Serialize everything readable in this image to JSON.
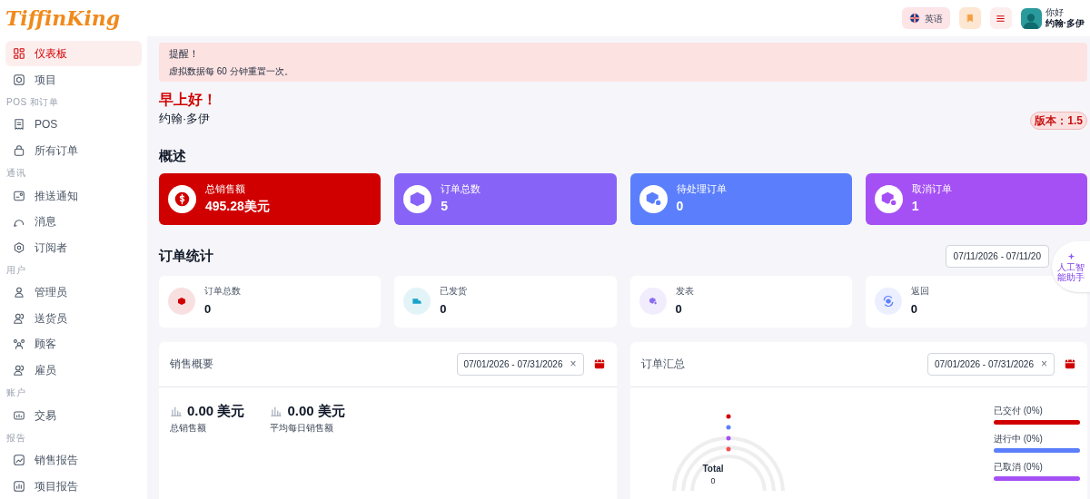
{
  "header": {
    "logo": "TiffinKing",
    "language": "英语",
    "greeting": "你好",
    "user_name": "约翰·多伊"
  },
  "sidebar": [
    {
      "kind": "item",
      "label": "仪表板",
      "selected": true
    },
    {
      "kind": "item",
      "label": "项目",
      "selected": false
    },
    {
      "kind": "section",
      "label": "POS 和订单"
    },
    {
      "kind": "item",
      "label": "POS",
      "selected": false
    },
    {
      "kind": "item",
      "label": "所有订单",
      "selected": false
    },
    {
      "kind": "section",
      "label": "通讯"
    },
    {
      "kind": "item",
      "label": "推送通知",
      "selected": false
    },
    {
      "kind": "item",
      "label": "消息",
      "selected": false
    },
    {
      "kind": "item",
      "label": "订阅者",
      "selected": false
    },
    {
      "kind": "section",
      "label": "用户"
    },
    {
      "kind": "item",
      "label": "管理员",
      "selected": false
    },
    {
      "kind": "item",
      "label": "送货员",
      "selected": false
    },
    {
      "kind": "item",
      "label": "顾客",
      "selected": false
    },
    {
      "kind": "item",
      "label": "雇员",
      "selected": false
    },
    {
      "kind": "section",
      "label": "账户"
    },
    {
      "kind": "item",
      "label": "交易",
      "selected": false
    },
    {
      "kind": "section",
      "label": "报告"
    },
    {
      "kind": "item",
      "label": "销售报告",
      "selected": false
    },
    {
      "kind": "item",
      "label": "项目报告",
      "selected": false
    }
  ],
  "alert": {
    "title": "提醒！",
    "message": "虚拟数据每 60 分钟重置一次。"
  },
  "welcome": {
    "greeting": "早上好！",
    "name": "约翰·多伊",
    "version": "版本：1.5"
  },
  "overview": {
    "title": "概述",
    "cards": [
      {
        "label": "总销售额",
        "value": "495.28美元",
        "color": "#d10000"
      },
      {
        "label": "订单总数",
        "value": "5",
        "color": "#8764f7"
      },
      {
        "label": "待处理订单",
        "value": "0",
        "color": "#5b7ffc"
      },
      {
        "label": "取消订单",
        "value": "1",
        "color": "#a550f5"
      }
    ]
  },
  "order_stats": {
    "title": "订单统计",
    "date_range": "07/11/2026 - 07/11/20",
    "stats": [
      {
        "label": "订单总数",
        "value": "0",
        "color": "#d10000"
      },
      {
        "label": "已发货",
        "value": "0",
        "color": "#1aa3c7"
      },
      {
        "label": "发表",
        "value": "0",
        "color": "#8b6cf0"
      },
      {
        "label": "返回",
        "value": "0",
        "color": "#5b7ffc"
      }
    ]
  },
  "ai_assistant": {
    "label": "人工智能助手"
  },
  "sales_overview": {
    "title": "销售概要",
    "date_range": "07/01/2026 - 07/31/2026",
    "clear": "×",
    "metrics": [
      {
        "value": "0.00 美元",
        "label": "总销售额"
      },
      {
        "value": "0.00 美元",
        "label": "平均每日销售额"
      }
    ]
  },
  "order_summary": {
    "title": "订单汇总",
    "date_range": "07/01/2026 - 07/31/2026",
    "clear": "×",
    "total_label": "Total",
    "total_value": "0",
    "legend": [
      {
        "label": "已交付 (0%)",
        "color": "#d10000"
      },
      {
        "label": "进行中 (0%)",
        "color": "#5b7ffc"
      },
      {
        "label": "已取消 (0%)",
        "color": "#a550f5"
      }
    ]
  }
}
